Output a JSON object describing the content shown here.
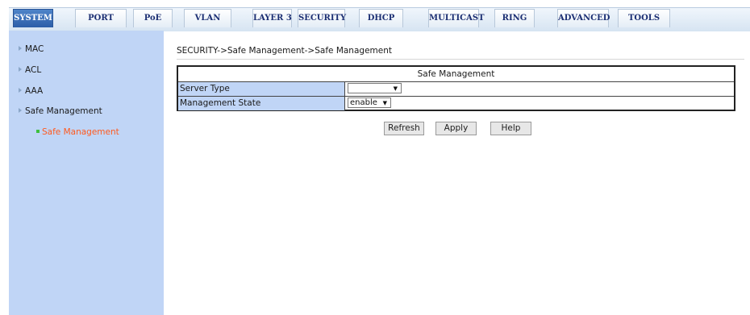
{
  "tabs": [
    {
      "label": "SYSTEM",
      "active": true
    },
    {
      "label": "PORT",
      "active": false
    },
    {
      "label": "PoE",
      "active": false
    },
    {
      "label": "VLAN",
      "active": false
    },
    {
      "label": "LAYER 3",
      "active": false
    },
    {
      "label": "SECURITY",
      "active": false
    },
    {
      "label": "DHCP",
      "active": false
    },
    {
      "label": "MULTICAST",
      "active": false
    },
    {
      "label": "RING",
      "active": false
    },
    {
      "label": "ADVANCED",
      "active": false
    },
    {
      "label": "TOOLS",
      "active": false
    }
  ],
  "sidebar": {
    "items": [
      {
        "label": "MAC"
      },
      {
        "label": "ACL"
      },
      {
        "label": "AAA"
      },
      {
        "label": "Safe Management"
      }
    ],
    "active_sub_item": {
      "label": "Safe Management"
    }
  },
  "breadcrumb": "SECURITY->Safe Management->Safe Management",
  "panel": {
    "title": "Safe Management",
    "rows": [
      {
        "label": "Server Type",
        "value": ""
      },
      {
        "label": "Management State",
        "value": "enable"
      }
    ]
  },
  "buttons": {
    "refresh": "Refresh",
    "apply": "Apply",
    "help": "Help"
  },
  "colors": {
    "active_tab": "#2c5ea8",
    "sidebar_bg": "#c0d5f6",
    "active_sub_item": "#ff5a1f"
  }
}
